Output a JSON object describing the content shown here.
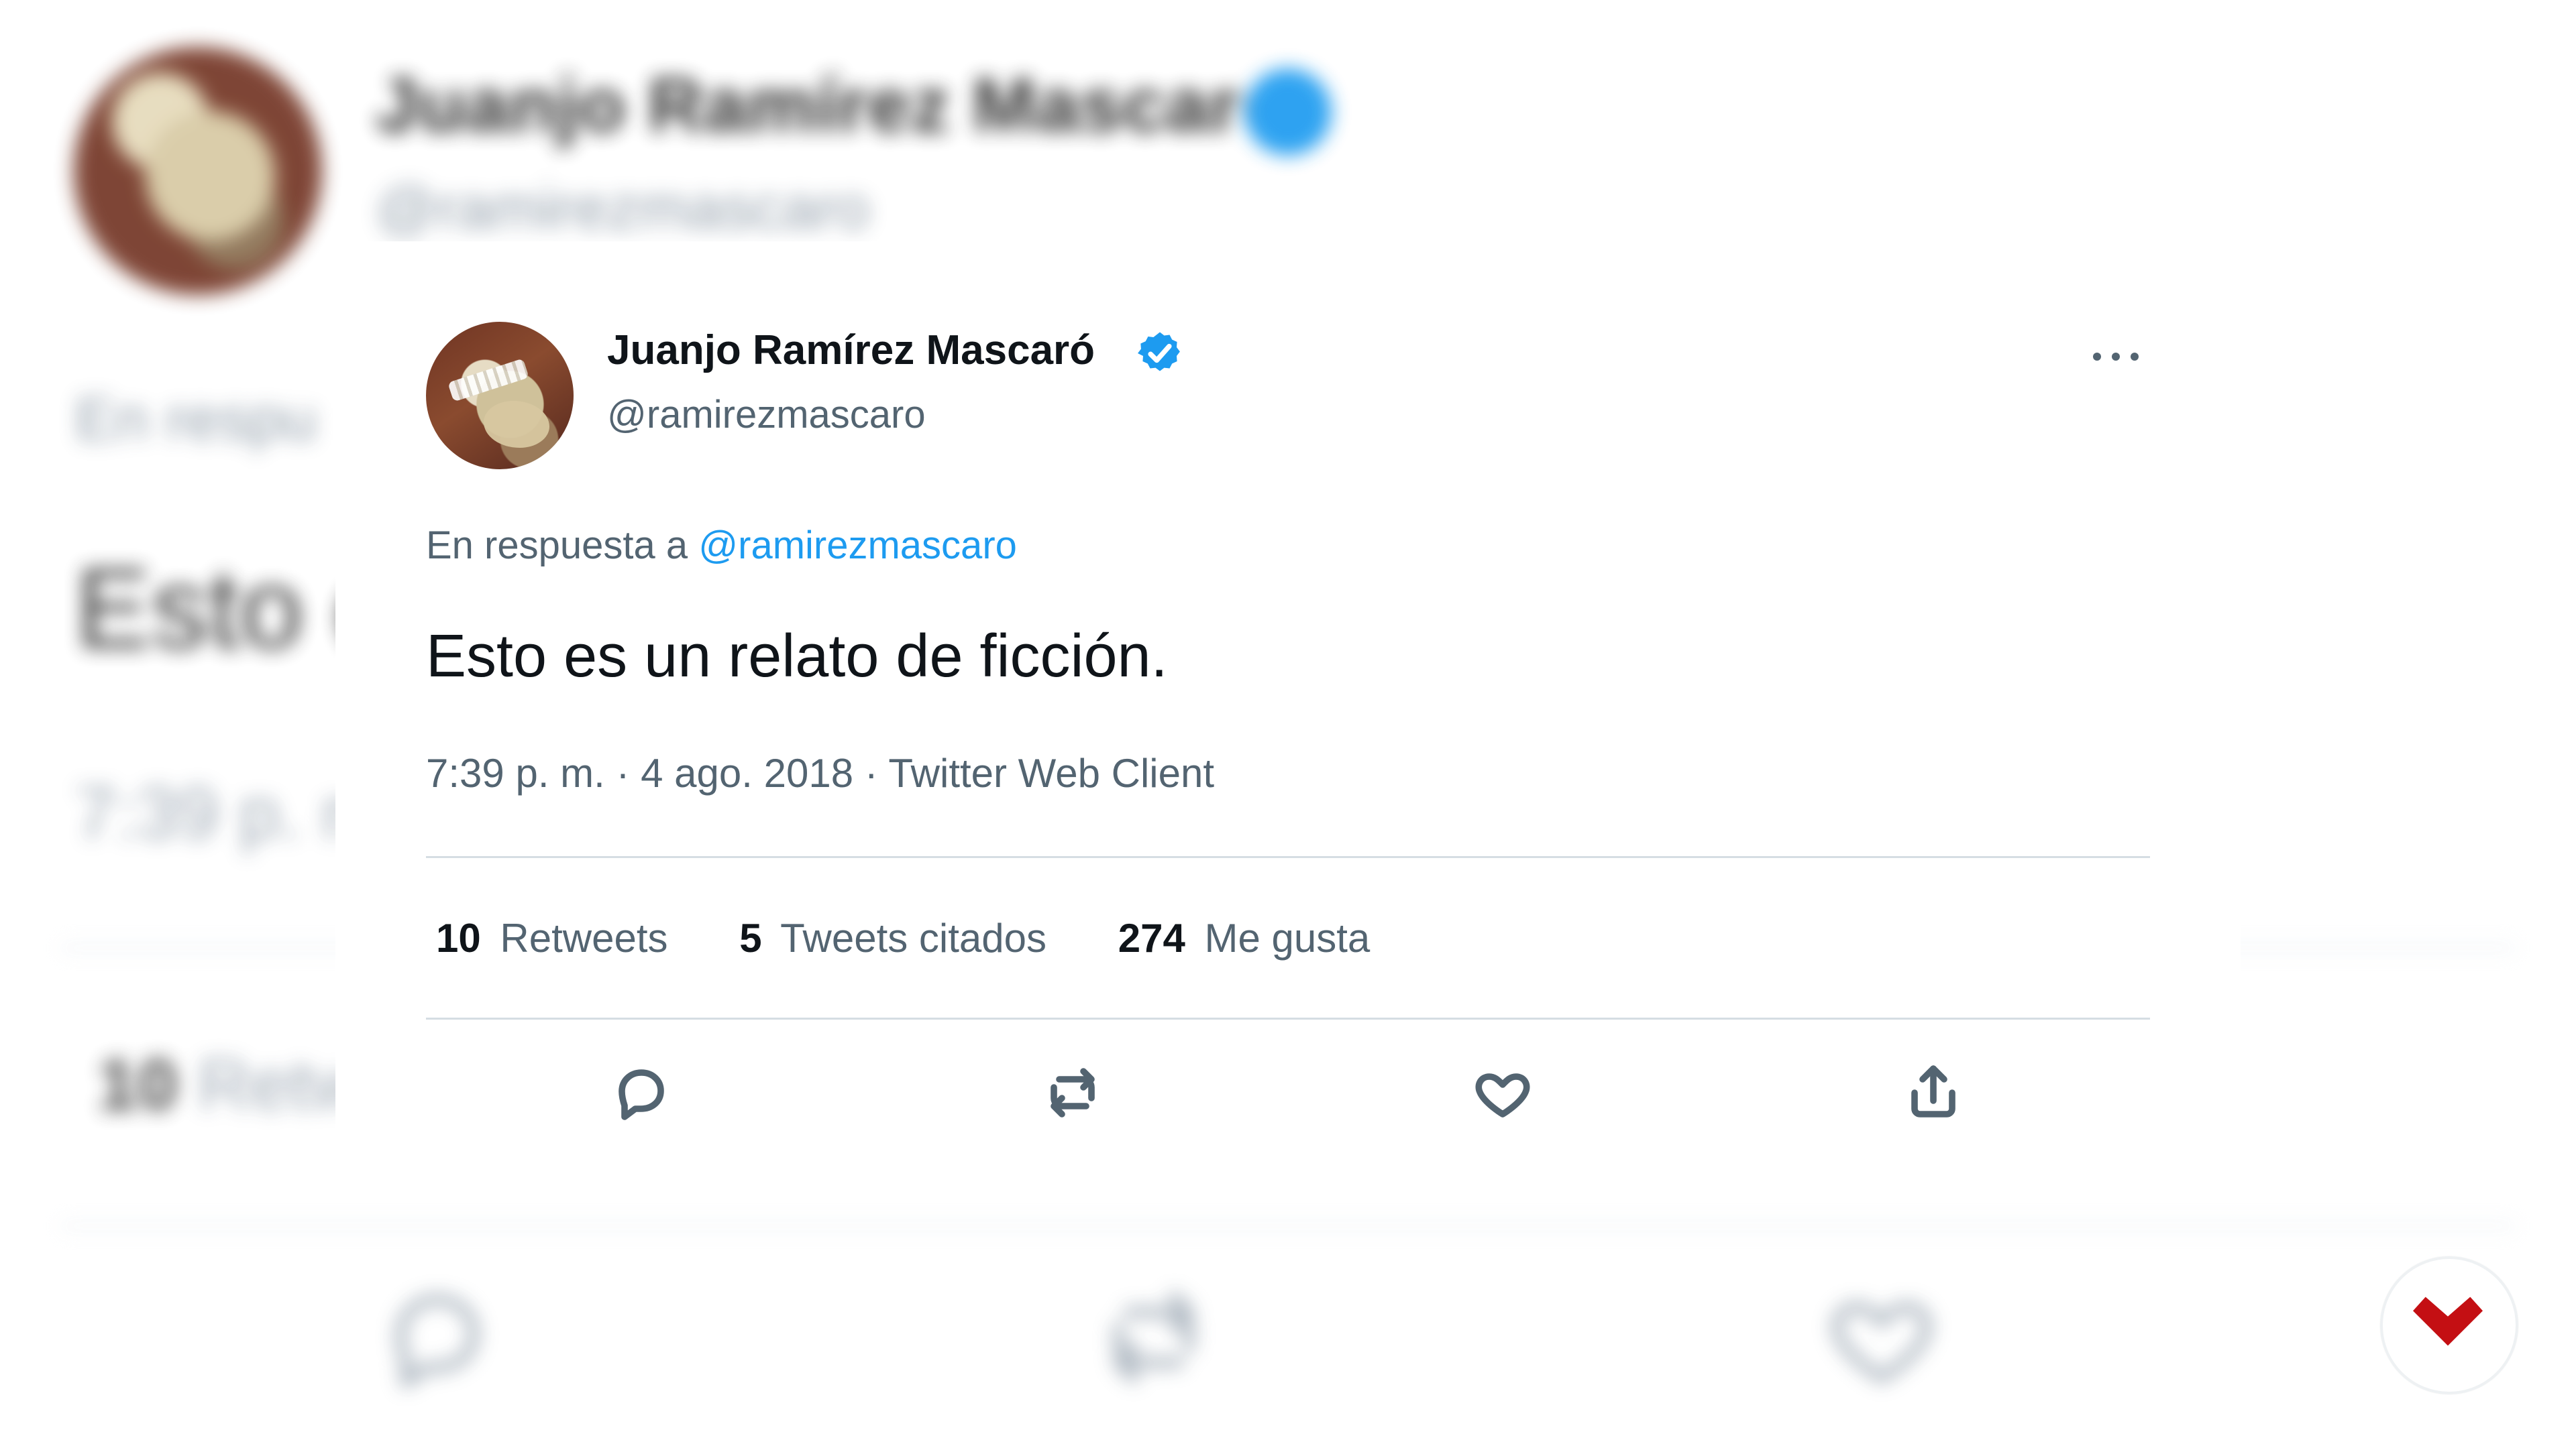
{
  "background": {
    "name": "Juanjo Ramírez Mascaró",
    "handle": "@ramirezmascaro",
    "reply_fragment": "En respu",
    "text_fragment": "Esto e",
    "time_fragment": "7:39 p. m",
    "stats_count_fragment": "10",
    "stats_label_fragment": "Retw"
  },
  "tweet": {
    "author_name": "Juanjo Ramírez Mascaró",
    "author_handle": "@ramirezmascaro",
    "reply_prefix": "En respuesta a",
    "reply_mention": "@ramirezmascaro",
    "text": "Esto es un relato de ficción.",
    "meta": "7:39 p. m. · 4 ago. 2018 · Twitter Web Client",
    "stats": [
      {
        "count": "10",
        "label": "Retweets"
      },
      {
        "count": "5",
        "label": "Tweets citados"
      },
      {
        "count": "274",
        "label": "Me gusta"
      }
    ]
  },
  "icons": {
    "verified": "verified-badge-icon",
    "more": "more-options-icon",
    "reply": "reply-icon",
    "retweet": "retweet-icon",
    "like": "heart-icon",
    "share": "share-icon",
    "corner": "brand-logo-icon"
  },
  "colors": {
    "primary_text": "#0f1419",
    "secondary_text": "#536471",
    "mention_blue": "#1d9bf0",
    "divider": "#d5dde3",
    "corner_red": "#c40f13"
  }
}
